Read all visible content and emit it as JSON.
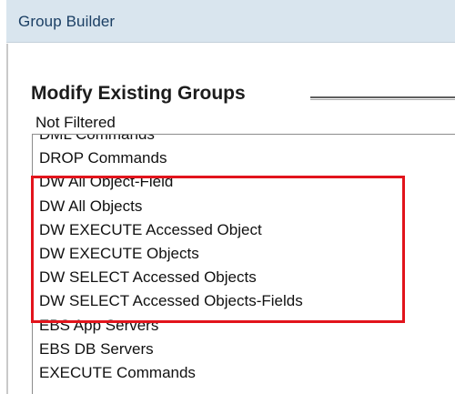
{
  "window": {
    "title": "Group Builder"
  },
  "section": {
    "heading": "Modify Existing Groups",
    "filter_label": "Not Filtered"
  },
  "groups_list": {
    "items": [
      "DML Commands",
      "DROP Commands",
      "DW All Object-Field",
      "DW All Objects",
      "DW EXECUTE Accessed Object",
      "DW EXECUTE Objects",
      "DW SELECT Accessed Objects",
      "DW SELECT Accessed Objects-Fields",
      "EBS App Servers",
      "EBS DB Servers",
      "EXECUTE Commands"
    ],
    "highlighted_range": "DW All Object-Field – DW SELECT Accessed Objects-Fields"
  },
  "colors": {
    "title_bar_bg": "#d9e5ee",
    "title_text": "#1b3f64",
    "highlight_border": "#e2141c"
  }
}
